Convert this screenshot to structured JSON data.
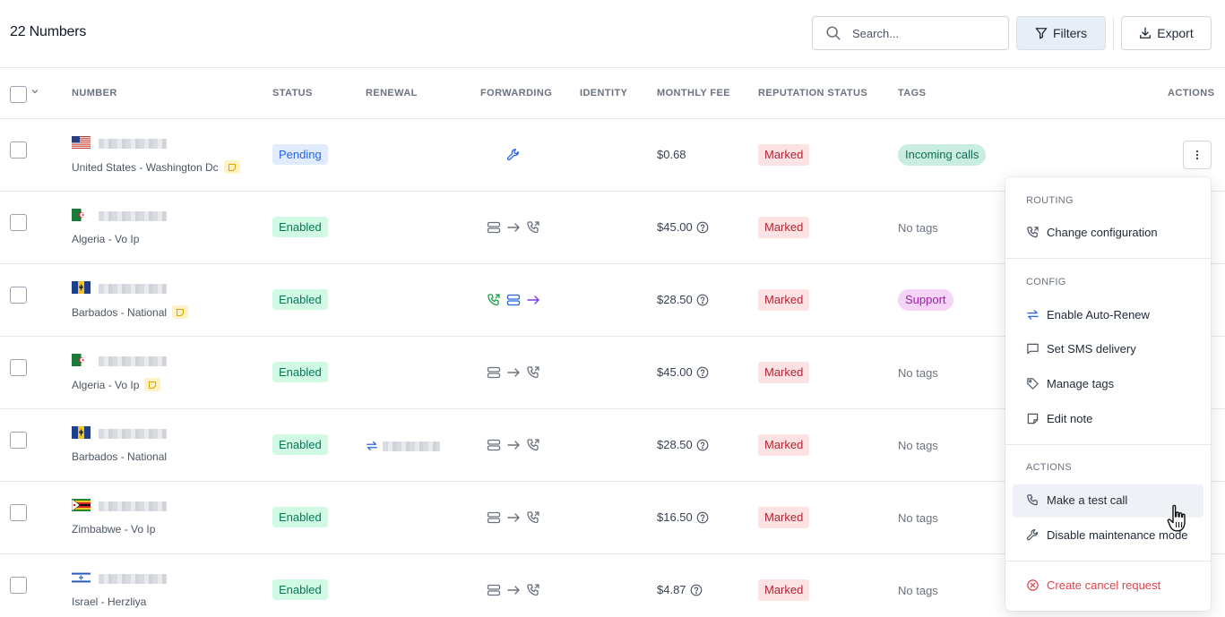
{
  "header": {
    "title": "22 Numbers",
    "search_placeholder": "Search...",
    "filters_label": "Filters",
    "export_label": "Export"
  },
  "columns": [
    "NUMBER",
    "STATUS",
    "RENEWAL",
    "FORWARDING",
    "IDENTITY",
    "MONTHLY FEE",
    "REPUTATION STATUS",
    "TAGS",
    "ACTIONS"
  ],
  "rows": [
    {
      "location": "United States - Washington Dc",
      "has_note": true,
      "status": "Pending",
      "forwarding": "maintenance",
      "fee": "$0.68",
      "fee_info": false,
      "reputation": "Marked",
      "tag": "Incoming calls",
      "tag_color": "green",
      "renewal": false,
      "flag": "us"
    },
    {
      "location": "Algeria - Vo Ip",
      "has_note": false,
      "status": "Enabled",
      "forwarding": "server-to-phone",
      "fee": "$45.00",
      "fee_info": true,
      "reputation": "Marked",
      "tag": "No tags",
      "tag_color": "none",
      "renewal": false,
      "flag": "dz"
    },
    {
      "location": "Barbados - National",
      "has_note": true,
      "status": "Enabled",
      "forwarding": "phone-server-arrow",
      "fee": "$28.50",
      "fee_info": true,
      "reputation": "Marked",
      "tag": "Support",
      "tag_color": "purple",
      "renewal": false,
      "flag": "bb"
    },
    {
      "location": "Algeria - Vo Ip",
      "has_note": true,
      "status": "Enabled",
      "forwarding": "server-to-phone",
      "fee": "$45.00",
      "fee_info": true,
      "reputation": "Marked",
      "tag": "No tags",
      "tag_color": "none",
      "renewal": false,
      "flag": "dz"
    },
    {
      "location": "Barbados - National",
      "has_note": false,
      "status": "Enabled",
      "forwarding": "server-to-phone",
      "fee": "$28.50",
      "fee_info": true,
      "reputation": "Marked",
      "tag": "No tags",
      "tag_color": "none",
      "renewal": true,
      "flag": "bb"
    },
    {
      "location": "Zimbabwe - Vo Ip",
      "has_note": false,
      "status": "Enabled",
      "forwarding": "server-to-phone",
      "fee": "$16.50",
      "fee_info": true,
      "reputation": "Marked",
      "tag": "No tags",
      "tag_color": "none",
      "renewal": false,
      "flag": "zw"
    },
    {
      "location": "Israel - Herzliya",
      "has_note": false,
      "status": "Enabled",
      "forwarding": "server-to-phone",
      "fee": "$4.87",
      "fee_info": true,
      "reputation": "Marked",
      "tag": "No tags",
      "tag_color": "none",
      "renewal": false,
      "flag": "il"
    }
  ],
  "menu": {
    "routing_label": "ROUTING",
    "change_configuration": "Change configuration",
    "config_label": "CONFIG",
    "enable_auto_renew": "Enable Auto-Renew",
    "set_sms_delivery": "Set SMS delivery",
    "manage_tags": "Manage tags",
    "edit_note": "Edit note",
    "actions_label": "ACTIONS",
    "make_test_call": "Make a test call",
    "disable_maintenance": "Disable maintenance mode",
    "create_cancel": "Create cancel request"
  },
  "colors": {
    "enabled_bg": "#d1fae5",
    "pending_bg": "#e0ecfb",
    "marked_bg": "#fde2e4",
    "danger": "#e0424e",
    "accent_blue": "#2563eb"
  }
}
